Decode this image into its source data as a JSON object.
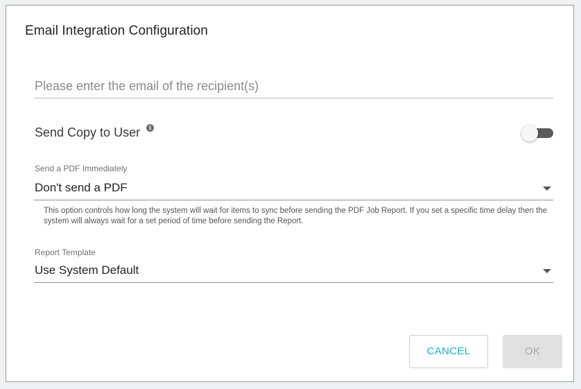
{
  "dialog": {
    "title": "Email Integration Configuration",
    "email": {
      "placeholder": "Please enter the email of the recipient(s)",
      "value": ""
    },
    "send_copy": {
      "label": "Send Copy to User",
      "info_icon": "info-icon",
      "info_glyph": "i",
      "enabled": false
    },
    "pdf": {
      "label": "Send a PDF Immediately",
      "selected": "Don't send a PDF",
      "help": "This option controls how long the system will wait for items to sync before sending the PDF Job Report. If you set a specific time delay then the system will always wait for a set period of time before sending the Report."
    },
    "template": {
      "label": "Report Template",
      "selected": "Use System Default"
    },
    "buttons": {
      "cancel": "CANCEL",
      "ok": "OK"
    }
  },
  "colors": {
    "accent": "#1bb1c9",
    "disabled_button_bg": "#e1e1e1",
    "disabled_button_text": "#a7a7a7",
    "toggle_track": "#5a5a5a"
  }
}
